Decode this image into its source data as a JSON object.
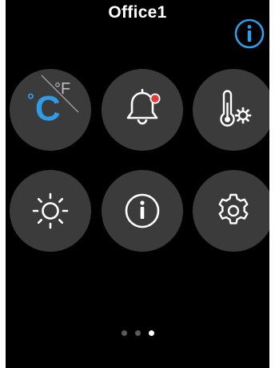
{
  "header": {
    "title": "Office1"
  },
  "tiles": {
    "unit_toggle": {
      "active_unit": "°C",
      "active_symbol": "C",
      "active_degree": "°",
      "inactive_unit": "°F",
      "icon": "temperature-unit-icon"
    },
    "alarm": {
      "icon": "alarm-bell-icon",
      "badge": "notification-dot"
    },
    "temp_settings": {
      "icon": "thermometer-gear-icon"
    },
    "brightness": {
      "icon": "brightness-sun-icon"
    },
    "info": {
      "icon": "info-icon"
    },
    "settings": {
      "icon": "gear-icon"
    }
  },
  "pager": {
    "pages": 3,
    "current": 3
  },
  "colors": {
    "background": "#000000",
    "tile": "#3b3b3b",
    "accent": "#2f9ce8",
    "icon": "#ffffff",
    "badge": "#e23b3b"
  }
}
